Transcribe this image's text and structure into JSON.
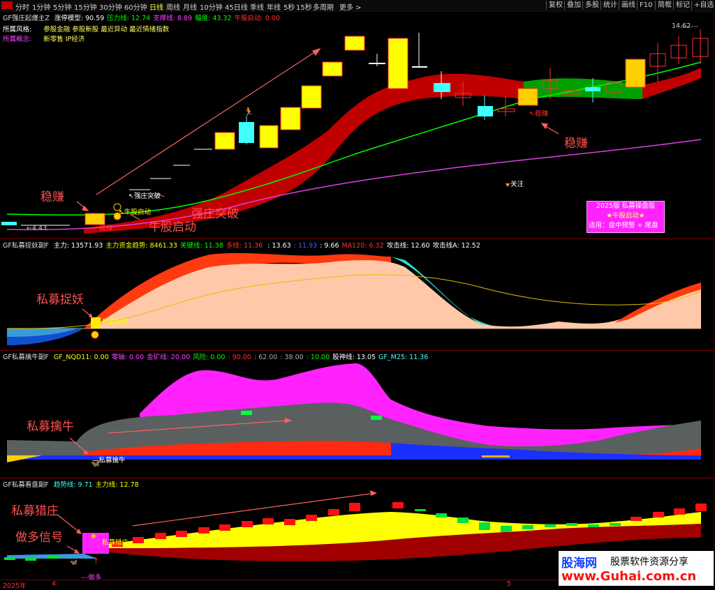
{
  "toolbar": {
    "periods": [
      "分时",
      "1分钟",
      "5分钟",
      "15分钟",
      "30分钟",
      "60分钟",
      "日线",
      "周线",
      "月线",
      "10分钟",
      "45日线",
      "季线",
      "年线",
      "5秒",
      "15秒",
      "多周期",
      "更多 >"
    ],
    "active": "日线",
    "right_buttons": [
      "复权",
      "叠加",
      "多股",
      "统计",
      "画线",
      "F10",
      "简框",
      "标记",
      "+自选"
    ]
  },
  "main_panel": {
    "indicator": "GF强庄起爆主Z",
    "values": [
      {
        "label": "涨停模型: 90.59",
        "color": "#ffffff"
      },
      {
        "label": "压力线: 12.74",
        "color": "#00ff00"
      },
      {
        "label": "支撑线: 8.89",
        "color": "#ff40ff"
      },
      {
        "label": "幅度: 43.32",
        "color": "#00ff00"
      },
      {
        "label": "牛股启动: 0.00",
        "color": "#ff3030"
      }
    ],
    "style_label": "所属风格:",
    "style_value": "参股金融 参股新股 最近异动 最近情绪指数",
    "concept_label": "所属概念:",
    "concept_value": "新零售 IP经济",
    "high_price": "14.62",
    "low_price": "4.43",
    "labels": {
      "qiangzhuang": "强庄突破",
      "niugu": "牛股启动",
      "wenzhuan": "稳赚",
      "guanzhu": "关注"
    },
    "annotations": {
      "wenzhuan": "稳赚",
      "qiangzhuang": "强庄突破",
      "niugu": "牛股启动"
    },
    "box": {
      "title": "2025版 私募操盘版",
      "line2": "★牛股启动★",
      "line3": "适用：盘中预警 + 尾盘"
    },
    "colors": {
      "up": "#ff3030",
      "down": "#40ffff",
      "yellow": "#ffff00",
      "green": "#00ff00",
      "magenta": "#ff40ff"
    }
  },
  "panel2": {
    "indicator": "GF私募捉妖副F",
    "values": [
      {
        "label": "主力: 13571.93",
        "color": "#ffffff"
      },
      {
        "label": "主力资金趋势: 8461.33",
        "color": "#ffff00"
      },
      {
        "label": "关键线: 11.38",
        "color": "#00ff00"
      },
      {
        "label": "多线: 11.36 ",
        "color": "#ff3030"
      },
      {
        "label": ": 13.63",
        "color": "#ffffff"
      },
      {
        "label": ": 11.93",
        "color": "#3060ff"
      },
      {
        "label": ": 9.66",
        "color": "#ffffff"
      },
      {
        "label": "MA120: 6.32",
        "color": "#ff3030"
      },
      {
        "label": "攻击线: 12.60",
        "color": "#ffffff"
      },
      {
        "label": "攻击线A: 12.52",
        "color": "#ffffff"
      }
    ],
    "annotation": "私募捉妖",
    "label": "私募捉妖"
  },
  "panel3": {
    "indicator": "GF私募擒牛副F",
    "values": [
      {
        "label": "GF_NQD11: 0.00",
        "color": "#ffff00"
      },
      {
        "label": "零轴: 0.00",
        "color": "#ff40ff"
      },
      {
        "label": "金矿线: 20.00",
        "color": "#ff40ff"
      },
      {
        "label": "风险: 0.00",
        "color": "#00ff00"
      },
      {
        "label": ": 90.00",
        "color": "#ff3030"
      },
      {
        "label": ": 62.00",
        "color": "#aaaaaa"
      },
      {
        "label": ": 38.00",
        "color": "#aaaaaa"
      },
      {
        "label": ": 10.00",
        "color": "#00ff00"
      },
      {
        "label": "股神线: 13.05",
        "color": "#ffffff"
      },
      {
        "label": "GF_M25: 11.36",
        "color": "#40ffff"
      }
    ],
    "annotation": "私募擒牛",
    "label": "私募擒牛"
  },
  "panel4": {
    "indicator": "GF私募看盘副F",
    "values": [
      {
        "label": "趋势线: 9.71",
        "color": "#40ffff"
      },
      {
        "label": "主力线: 12.78",
        "color": "#ffff00"
      }
    ],
    "annotation1": "私募猎庄",
    "annotation2": "做多信号",
    "label": "私募猎庄",
    "label2": "做多"
  },
  "axis": {
    "year": "2025年",
    "m1": "4",
    "m2": "5"
  },
  "watermark": {
    "title": "股海网",
    "subtitle": "股票软件资源分享",
    "url": "www.Guhai.com.cn"
  }
}
